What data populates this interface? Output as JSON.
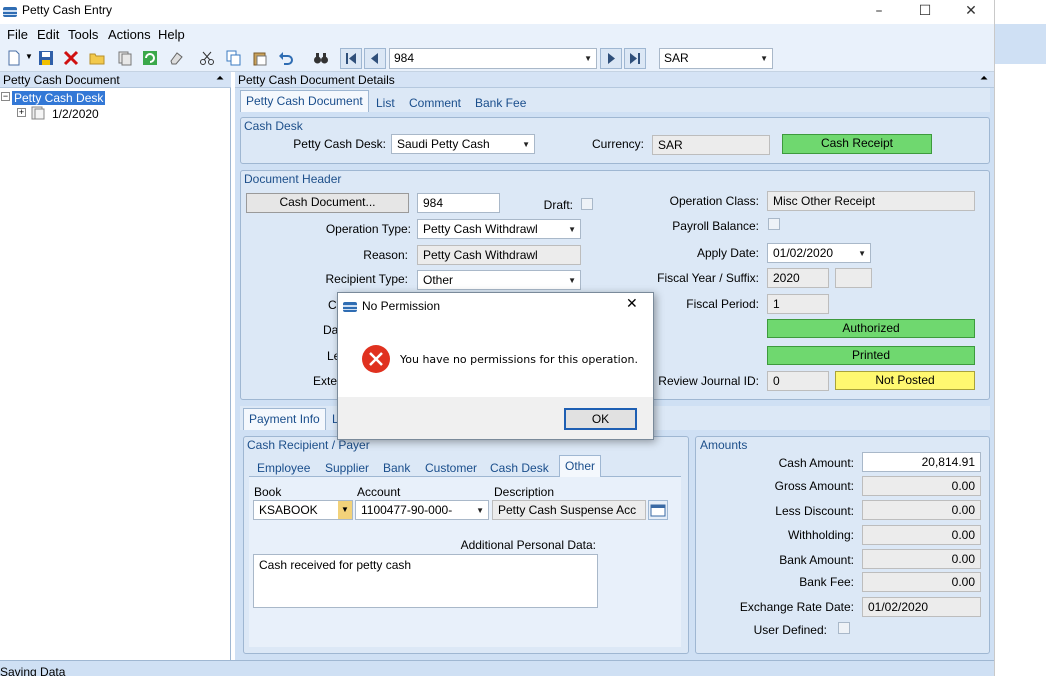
{
  "window": {
    "title": "Petty Cash Entry"
  },
  "menu": [
    "File",
    "Edit",
    "Tools",
    "Actions",
    "Help"
  ],
  "toolbar": {
    "record_value": "984",
    "currency_value": "SAR"
  },
  "left_panel": {
    "title": "Petty Cash Document",
    "root_label": "Petty Cash Desk",
    "child_label": "1/2/2020"
  },
  "right_panel": {
    "title": "Petty Cash Document Details"
  },
  "top_tabs": [
    "Petty Cash Document",
    "List",
    "Comment",
    "Bank Fee"
  ],
  "cash_desk": {
    "title": "Cash Desk",
    "desk_label": "Petty Cash Desk:",
    "desk_value": "Saudi Petty Cash",
    "currency_label": "Currency:",
    "currency_value": "SAR",
    "receipt_button": "Cash Receipt"
  },
  "doc_header": {
    "title": "Document Header",
    "cash_doc_button": "Cash Document...",
    "cash_doc_value": "984",
    "draft_label": "Draft:",
    "op_type_label": "Operation Type:",
    "op_type_value": "Petty Cash Withdrawl",
    "reason_label": "Reason:",
    "reason_value": "Petty Cash Withdrawl",
    "recipient_type_label": "Recipient Type:",
    "recipient_type_value": "Other",
    "hidden_label_1": "C",
    "hidden_label_2": "Da",
    "hidden_label_3": "Le",
    "hidden_label_4": "Exte",
    "op_class_label": "Operation Class:",
    "op_class_value": "Misc Other Receipt",
    "payroll_label": "Payroll Balance:",
    "apply_date_label": "Apply Date:",
    "apply_date_value": "01/02/2020",
    "fiscal_year_label": "Fiscal Year / Suffix:",
    "fiscal_year_value": "2020",
    "fiscal_period_label": "Fiscal Period:",
    "fiscal_period_value": "1",
    "authorized_status": "Authorized",
    "printed_status": "Printed",
    "review_label": "Review Journal ID:",
    "review_value": "0",
    "posted_status": "Not Posted"
  },
  "bottom_tabs": [
    "Payment Info",
    "L"
  ],
  "recipient": {
    "title": "Cash Recipient / Payer",
    "tabs": [
      "Employee",
      "Supplier",
      "Bank",
      "Customer",
      "Cash Desk",
      "Other"
    ],
    "book_label": "Book",
    "book_value": "KSABOOK",
    "account_label": "Account",
    "account_value": "1100477-90-000-",
    "desc_label": "Description",
    "desc_value": "Petty Cash Suspense Acc",
    "additional_label": "Additional Personal Data:",
    "additional_value": "Cash received for petty cash"
  },
  "amounts": {
    "title": "Amounts",
    "cash_amount_label": "Cash Amount:",
    "cash_amount": "20,814.91",
    "gross_label": "Gross Amount:",
    "gross": "0.00",
    "discount_label": "Less Discount:",
    "discount": "0.00",
    "withholding_label": "Withholding:",
    "withholding": "0.00",
    "bank_amount_label": "Bank Amount:",
    "bank_amount": "0.00",
    "bank_fee_label": "Bank Fee:",
    "bank_fee": "0.00",
    "exchange_label": "Exchange Rate Date:",
    "exchange": "01/02/2020",
    "user_defined_label": "User Defined:"
  },
  "status_bar": {
    "text": "Saving Data"
  },
  "dialog": {
    "title": "No Permission",
    "message": "You have no permissions for this operation.",
    "ok_label": "OK"
  }
}
